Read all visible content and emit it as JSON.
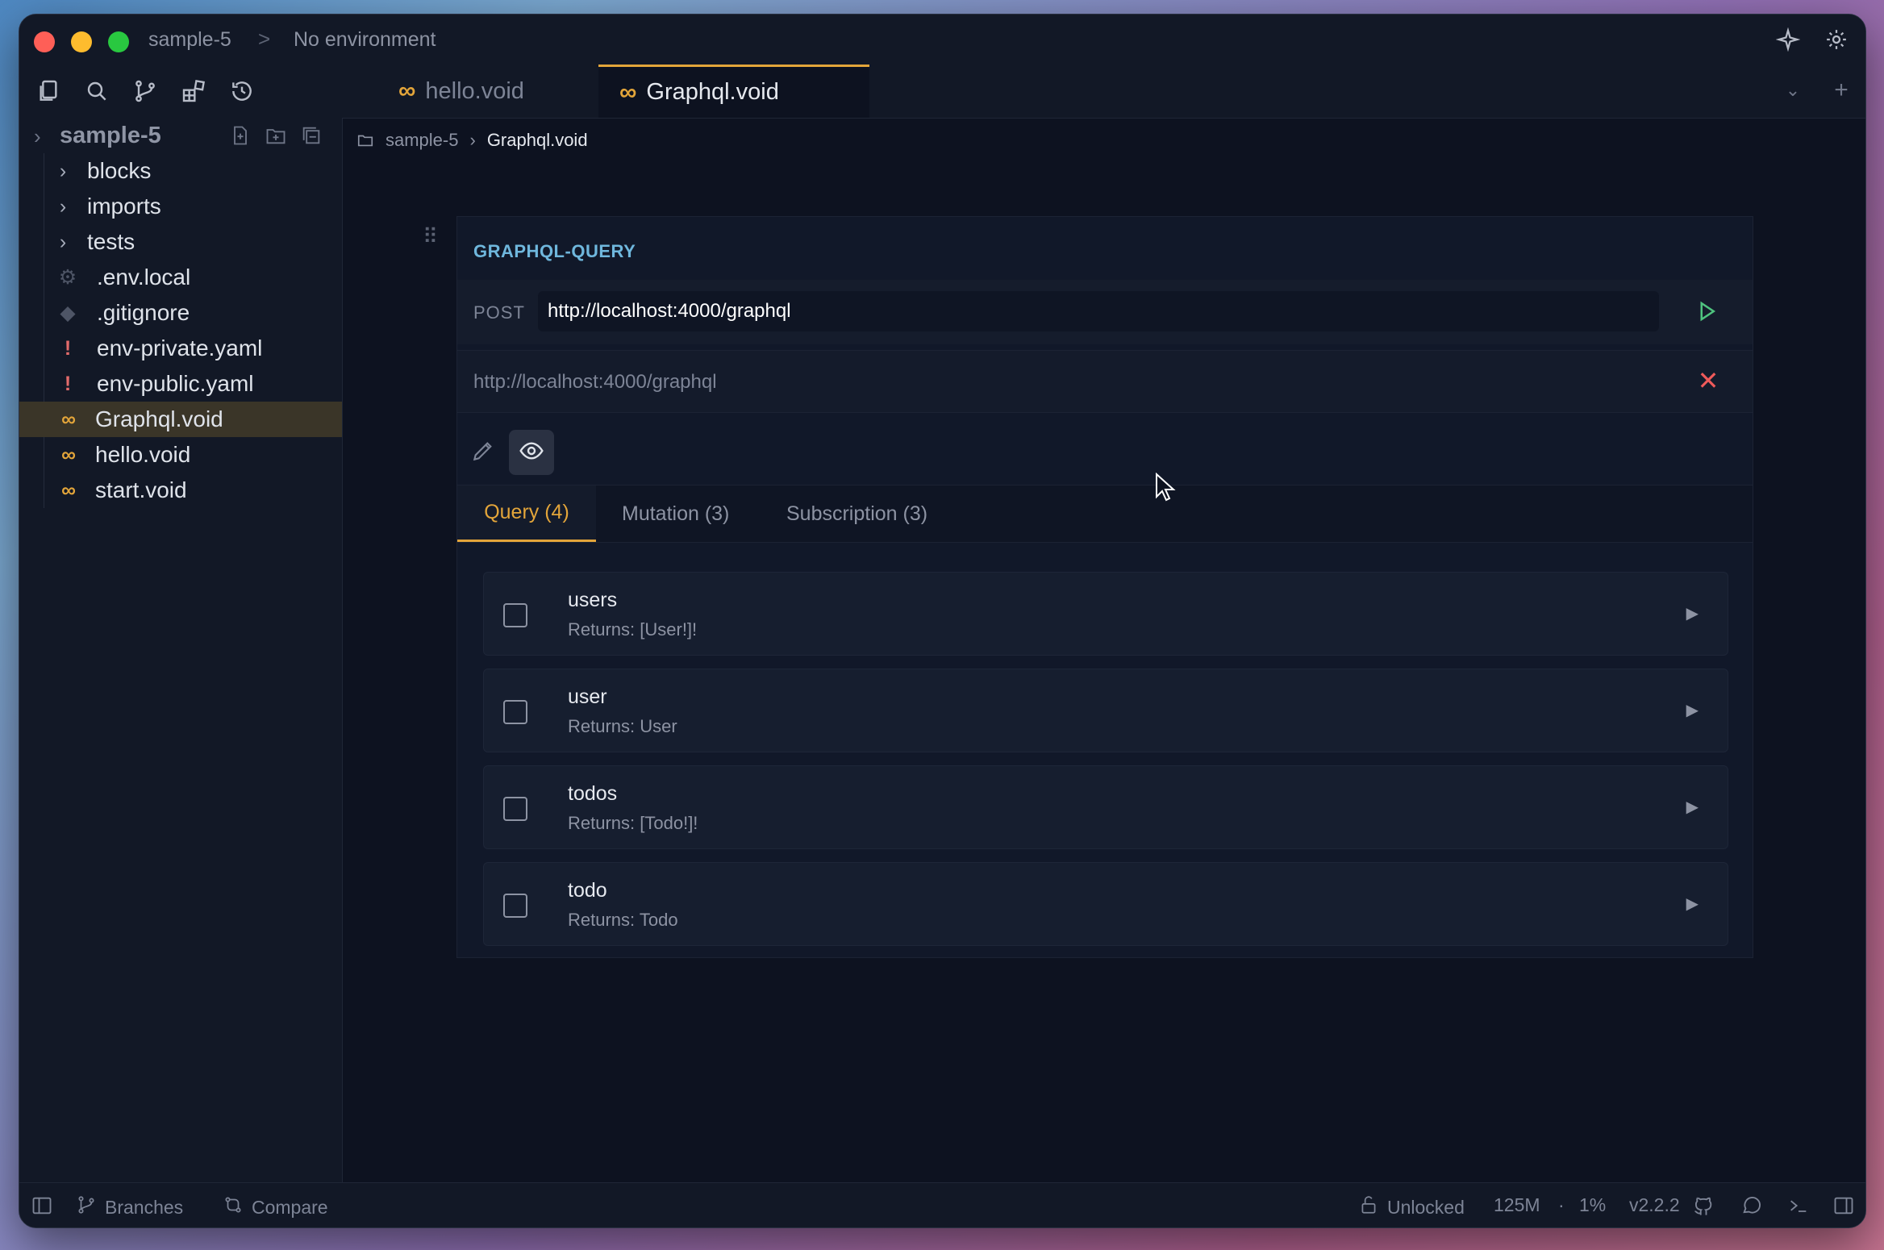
{
  "titlebar": {
    "project": "sample-5",
    "separator": ">",
    "environment": "No environment"
  },
  "tabs": [
    {
      "label": "hello.void",
      "icon": "infinity-icon"
    },
    {
      "label": "Graphql.void",
      "icon": "infinity-icon"
    }
  ],
  "sidebar": {
    "root": "sample-5",
    "items": [
      {
        "label": "blocks",
        "type": "folder"
      },
      {
        "label": "imports",
        "type": "folder"
      },
      {
        "label": "tests",
        "type": "folder"
      },
      {
        "label": ".env.local",
        "type": "gear"
      },
      {
        "label": ".gitignore",
        "type": "git"
      },
      {
        "label": "env-private.yaml",
        "type": "yaml"
      },
      {
        "label": "env-public.yaml",
        "type": "yaml"
      },
      {
        "label": "Graphql.void",
        "type": "void"
      },
      {
        "label": "hello.void",
        "type": "void"
      },
      {
        "label": "start.void",
        "type": "void"
      }
    ]
  },
  "breadcrumb": {
    "folder": "sample-5",
    "file": "Graphql.void"
  },
  "block": {
    "title": "GRAPHQL-QUERY",
    "method": "POST",
    "url": "http://localhost:4000/graphql",
    "endpoint": "http://localhost:4000/graphql",
    "type_tabs": [
      "Query (4)",
      "Mutation (3)",
      "Subscription (3)"
    ],
    "operations": [
      {
        "name": "users",
        "returns": "Returns: [User!]!"
      },
      {
        "name": "user",
        "returns": "Returns: User"
      },
      {
        "name": "todos",
        "returns": "Returns: [Todo!]!"
      },
      {
        "name": "todo",
        "returns": "Returns: Todo"
      }
    ]
  },
  "statusbar": {
    "branches": "Branches",
    "compare": "Compare",
    "lock": "Unlocked",
    "memory": "125M",
    "dot": "·",
    "cpu": "1%",
    "version": "v2.2.2"
  },
  "colors": {
    "accent": "#e3a53a",
    "title_blue": "#6fb7dd",
    "run_green": "#4fc37f",
    "close_red": "#ef5a5a"
  }
}
